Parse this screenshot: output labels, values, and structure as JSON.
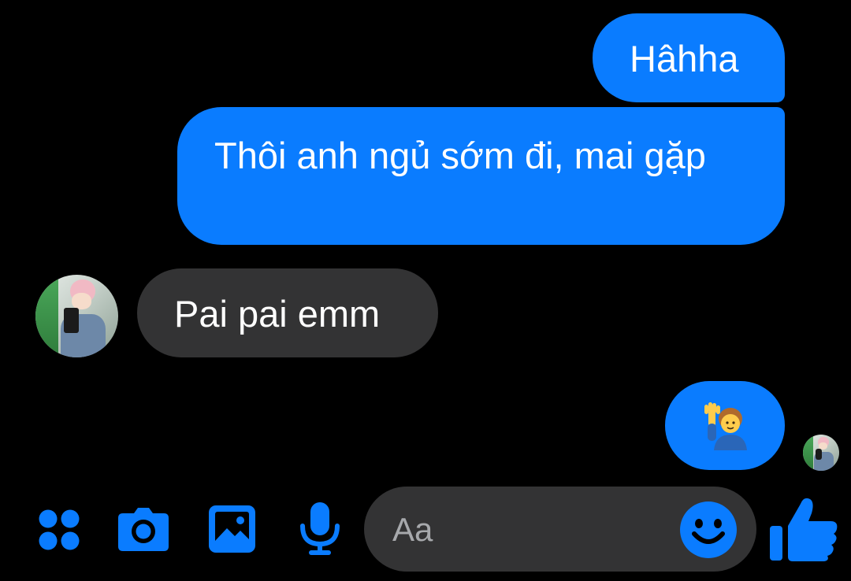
{
  "messages": [
    {
      "direction": "sent",
      "text": "Hâhha"
    },
    {
      "direction": "sent",
      "text": "Thôi anh ngủ sớm đi, mai gặp"
    },
    {
      "direction": "received",
      "text": "Pai pai emm"
    },
    {
      "direction": "sent",
      "text": "🙋‍♂️"
    }
  ],
  "composer": {
    "placeholder": "Aa",
    "icons": [
      "apps-icon",
      "camera-icon",
      "gallery-icon",
      "microphone-icon",
      "emoji-icon",
      "thumbs-up-icon"
    ]
  },
  "colors": {
    "background": "#000000",
    "sent_bubble": "#0a7cff",
    "received_bubble": "#333334",
    "accent": "#0a7cff",
    "placeholder_text": "#a7a9ac"
  }
}
